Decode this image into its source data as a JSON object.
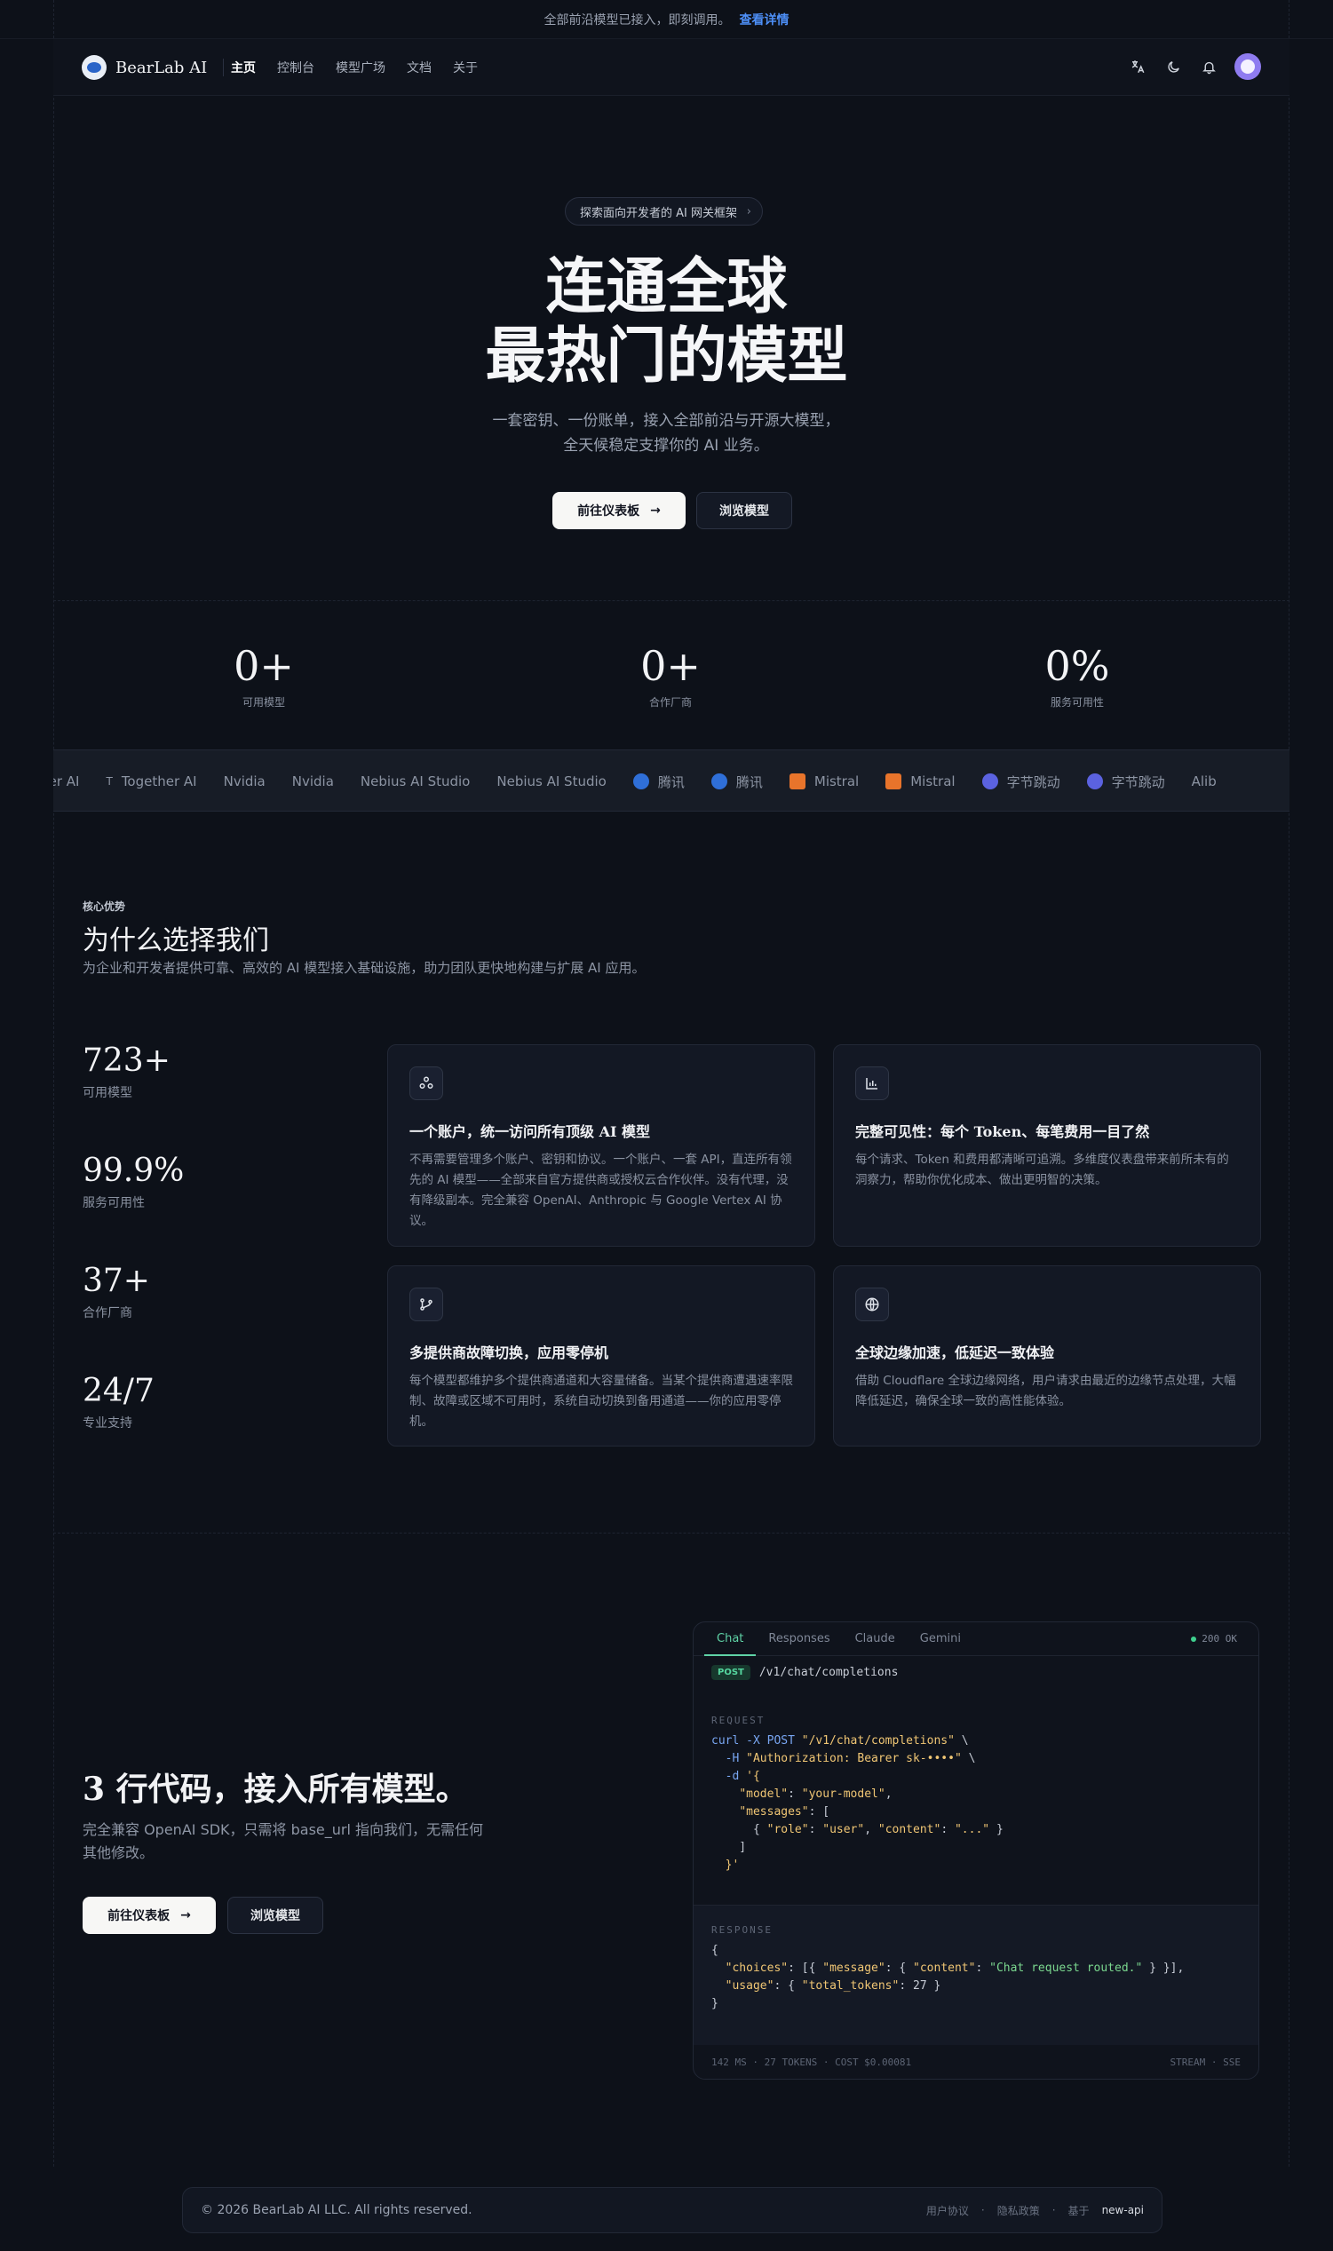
{
  "announcement": {
    "text": "全部前沿模型已接入，即刻调用。",
    "link": "查看详情"
  },
  "nav": {
    "brand": "BearLab AI",
    "links": [
      "主页",
      "控制台",
      "模型广场",
      "文档",
      "关于"
    ]
  },
  "hero": {
    "pill": "探索面向开发者的 AI 网关框架",
    "title_line1": "连通全球",
    "title_line2": "最热门的模型",
    "subtitle": "一套密钥、一份账单，接入全部前沿与开源大模型，全天候稳定支撑你的 AI 业务。",
    "primary_button": "前往仪表板",
    "secondary_button": "浏览模型"
  },
  "stats": [
    {
      "value": "0+",
      "label": "可用模型"
    },
    {
      "value": "0+",
      "label": "合作厂商"
    },
    {
      "value": "0%",
      "label": "服务可用性"
    }
  ],
  "providers": [
    {
      "name": "ether AI",
      "icon": ""
    },
    {
      "name": "Together AI",
      "icon": "T"
    },
    {
      "name": "Nvidia",
      "icon": ""
    },
    {
      "name": "Nvidia",
      "icon": ""
    },
    {
      "name": "Nebius AI Studio",
      "icon": ""
    },
    {
      "name": "Nebius AI Studio",
      "icon": ""
    },
    {
      "name": "腾讯",
      "icon": "tencent-icon"
    },
    {
      "name": "腾讯",
      "icon": "tencent-icon"
    },
    {
      "name": "Mistral",
      "icon": "mistral-icon"
    },
    {
      "name": "Mistral",
      "icon": "mistral-icon"
    },
    {
      "name": "字节跳动",
      "icon": "bytedance-icon"
    },
    {
      "name": "字节跳动",
      "icon": "bytedance-icon"
    },
    {
      "name": "Alib",
      "icon": ""
    }
  ],
  "features": {
    "eyebrow": "核心优势",
    "title": "为什么选择我们",
    "description": "为企业和开发者提供可靠、高效的 AI 模型接入基础设施，助力团队更快地构建与扩展 AI 应用。",
    "key_stats": [
      {
        "value": "723+",
        "label": "可用模型"
      },
      {
        "value": "99.9%",
        "label": "服务可用性"
      },
      {
        "value": "37+",
        "label": "合作厂商"
      },
      {
        "value": "24/7",
        "label": "专业支持"
      }
    ],
    "cards": [
      {
        "icon": "nodes-icon",
        "title": "一个账户，统一访问所有顶级 AI 模型",
        "text": "不再需要管理多个账户、密钥和协议。一个账户、一套 API，直连所有领先的 AI 模型——全部来自官方提供商或授权云合作伙伴。没有代理，没有降级副本。完全兼容 OpenAI、Anthropic 与 Google Vertex AI 协议。"
      },
      {
        "icon": "bar-chart-icon",
        "title": "完整可见性：每个 Token、每笔费用一目了然",
        "text": "每个请求、Token 和费用都清晰可追溯。多维度仪表盘带来前所未有的洞察力，帮助你优化成本、做出更明智的决策。"
      },
      {
        "icon": "git-branch-icon",
        "title": "多提供商故障切换，应用零停机",
        "text": "每个模型都维护多个提供商通道和大容量储备。当某个提供商遭遇速率限制、故障或区域不可用时，系统自动切换到备用通道——你的应用零停机。"
      },
      {
        "icon": "globe-icon",
        "title": "全球边缘加速，低延迟一致体验",
        "text": "借助 Cloudflare 全球边缘网络，用户请求由最近的边缘节点处理，大幅降低延迟，确保全球一致的高性能体验。"
      }
    ]
  },
  "integration": {
    "title": "3 行代码，接入所有模型。",
    "description": "完全兼容 OpenAI SDK，只需将 base_url 指向我们，无需任何其他修改。",
    "primary_button": "前往仪表板",
    "secondary_button": "浏览模型"
  },
  "code_panel": {
    "tabs": [
      "Chat",
      "Responses",
      "Claude",
      "Gemini"
    ],
    "status": "200 OK",
    "method": "POST",
    "endpoint": "/v1/chat/completions",
    "request_label": "REQUEST",
    "response_label": "RESPONSE",
    "meta_left": "142 MS  ·  27 TOKENS  ·  COST $0.00081",
    "meta_right": "STREAM · SSE"
  },
  "footer": {
    "copyright": "© 2026 BearLab AI LLC. All rights reserved.",
    "links": [
      "用户协议",
      "隐私政策"
    ],
    "powered_prefix": "基于",
    "powered_name": "new-api"
  },
  "colors": {
    "background": "#0d1119",
    "accent_green": "#5fd3a6",
    "link_blue": "#4d8ff7"
  }
}
